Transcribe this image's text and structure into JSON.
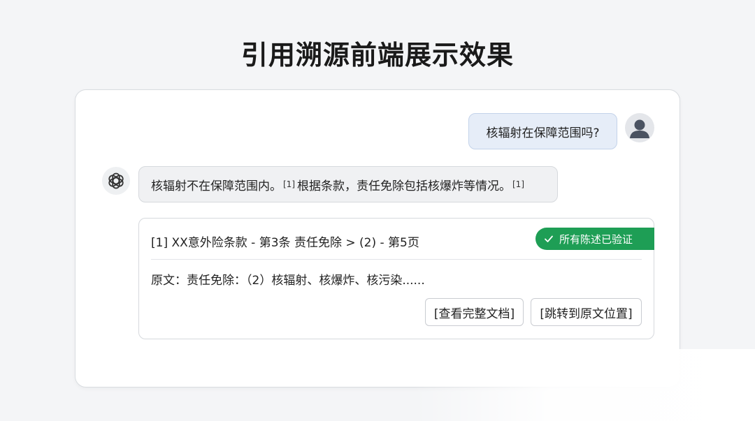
{
  "page": {
    "title": "引用溯源前端展示效果"
  },
  "chat": {
    "user_message": "核辐射在保障范围吗?",
    "bot_message": {
      "part1": "核辐射不在保障范围内。",
      "cite1": "[1]",
      "part2": "根据条款，责任免除包括核爆炸等情况。",
      "cite2": "[1]"
    }
  },
  "source": {
    "title": "[1] XX意外险条款 - 第3条 责任免除 > (2) - 第5页",
    "verified_label": "所有陈述已验证",
    "excerpt": "原文：责任免除：（2）核辐射、核爆炸、核污染......",
    "view_button": "[查看完整文档]",
    "jump_button": "[跳转到原文位置]"
  },
  "colors": {
    "user_bubble": "#e6edf8",
    "bot_bubble": "#f0f1f3",
    "verified": "#1e9e55"
  },
  "icons": {
    "user_avatar": "person-icon",
    "bot_avatar": "openai-logo-icon",
    "verified": "check-icon"
  }
}
